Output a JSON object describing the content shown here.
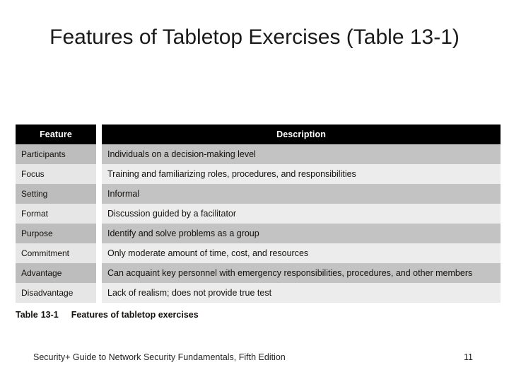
{
  "slide": {
    "title": "Features of Tabletop Exercises (Table 13-1)",
    "background_color": "#ffffff"
  },
  "table": {
    "header_background": "#000000",
    "header_text_color": "#ffffff",
    "row_band_dark": "#c3c3c3",
    "row_band_light": "#ececec",
    "columns": [
      "Feature",
      "Description"
    ],
    "rows": [
      {
        "feature": "Participants",
        "description": "Individuals on a decision-making level"
      },
      {
        "feature": "Focus",
        "description": "Training and familiarizing roles, procedures, and responsibilities"
      },
      {
        "feature": "Setting",
        "description": "Informal"
      },
      {
        "feature": "Format",
        "description": "Discussion guided by a facilitator"
      },
      {
        "feature": "Purpose",
        "description": "Identify and solve problems as a group"
      },
      {
        "feature": "Commitment",
        "description": "Only moderate amount of time, cost, and resources"
      },
      {
        "feature": "Advantage",
        "description": "Can acquaint key personnel with emergency responsibilities, procedures, and other members"
      },
      {
        "feature": "Disadvantage",
        "description": "Lack of realism; does not provide true test"
      }
    ]
  },
  "caption": {
    "label": "Table",
    "number": "13-1",
    "text": "Features of tabletop exercises"
  },
  "footer": {
    "source": "Security+ Guide to Network Security Fundamentals, Fifth Edition",
    "page_number": "11"
  }
}
